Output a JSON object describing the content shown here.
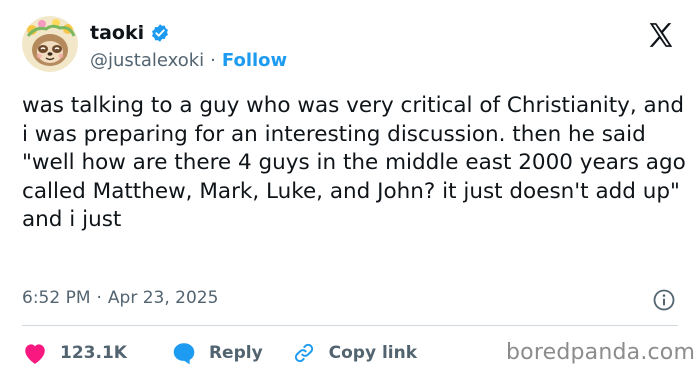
{
  "author": {
    "display_name": "taoki",
    "handle": "@justalexoki",
    "separator": "·",
    "follow_label": "Follow",
    "avatar_icon": "sloth-avatar-icon",
    "verified_icon": "verified-badge-icon",
    "verified_color": "#1d9bf0"
  },
  "brand": {
    "logo_icon": "x-logo-icon"
  },
  "tweet": {
    "text": "was talking to a guy who was very critical of Christianity, and i was preparing for an interesting discussion. then he said \"well how are there 4 guys in the middle east 2000 years ago called Matthew, Mark, Luke, and John? it just doesn't add up\" and i just",
    "time": "6:52 PM",
    "date_separator": "·",
    "date": "Apr 23, 2025"
  },
  "actions": {
    "like_count": "123.1K",
    "like_color": "#f91880",
    "reply_label": "Reply",
    "reply_color": "#1d9bf0",
    "copy_link_label": "Copy link",
    "copy_link_color": "#1d9bf0"
  },
  "watermark": {
    "text": "boredpanda.com"
  },
  "colors": {
    "text_primary": "#0f1419",
    "text_secondary": "#536471",
    "divider": "#cfd9de",
    "accent": "#1d9bf0"
  }
}
